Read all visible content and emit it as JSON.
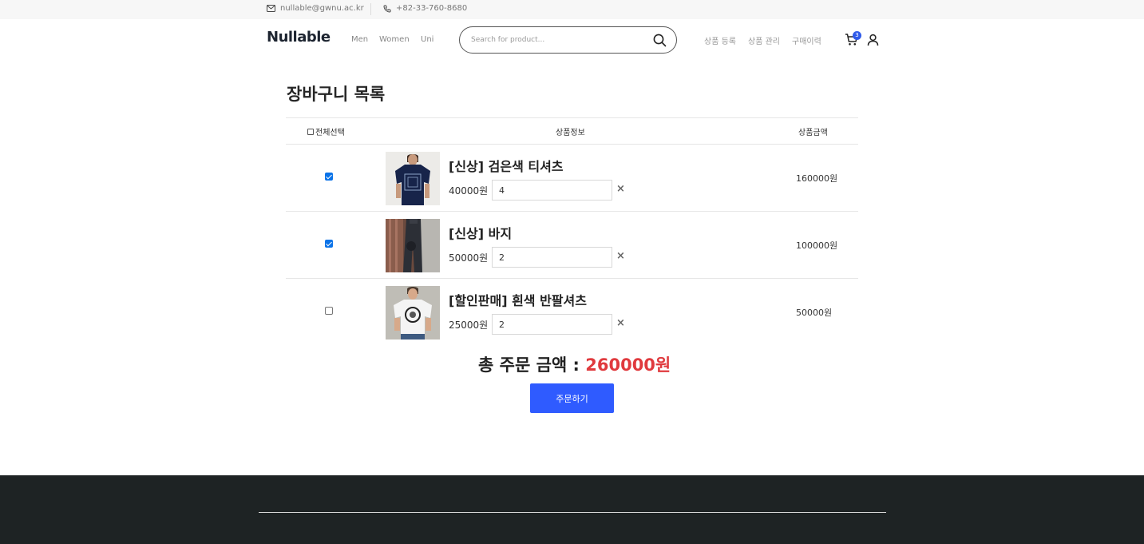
{
  "topbar": {
    "email": "nullable@gwnu.ac.kr",
    "phone": "+82-33-760-8680"
  },
  "header": {
    "logo": "Nullable",
    "nav": [
      "Men",
      "Women",
      "Uni"
    ],
    "search_placeholder": "Search for product...",
    "links": [
      "상품 등록",
      "상품 관리",
      "구매이력"
    ],
    "cart_count": "3"
  },
  "page": {
    "title": "장바구니 목록"
  },
  "table": {
    "headers": {
      "select_all": "전체선택",
      "info": "상품정보",
      "price": "상품금액"
    },
    "rows": [
      {
        "checked": true,
        "name": "[신상] 검은색 티셔츠",
        "unit_price": "40000원",
        "qty": "4",
        "total": "160000원",
        "remove": "×"
      },
      {
        "checked": true,
        "name": "[신상] 바지",
        "unit_price": "50000원",
        "qty": "2",
        "total": "100000원",
        "remove": "×"
      },
      {
        "checked": false,
        "name": "[할인판매] 흰색 반팔셔츠",
        "unit_price": "25000원",
        "qty": "2",
        "total": "50000원",
        "remove": "×"
      }
    ]
  },
  "order": {
    "label": "총 주문 금액 : ",
    "amount": "260000원",
    "button": "주문하기"
  },
  "colors": {
    "accent": "#2f5bff",
    "amount": "#e03a3e",
    "footer_bg": "#1e2324"
  }
}
